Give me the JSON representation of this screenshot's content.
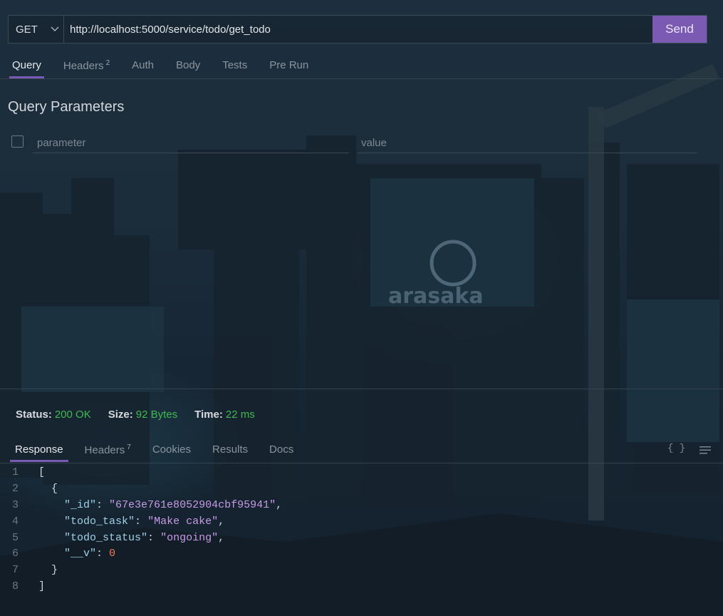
{
  "request": {
    "method": "GET",
    "url": "http://localhost:5000/service/todo/get_todo",
    "send_label": "Send"
  },
  "request_tabs": [
    {
      "label": "Query",
      "active": true
    },
    {
      "label": "Headers",
      "badge": "2"
    },
    {
      "label": "Auth"
    },
    {
      "label": "Body"
    },
    {
      "label": "Tests"
    },
    {
      "label": "Pre Run"
    }
  ],
  "query_params": {
    "title": "Query Parameters",
    "param_placeholder": "parameter",
    "value_placeholder": "value"
  },
  "status": {
    "status_label": "Status:",
    "status_value": "200 OK",
    "size_label": "Size:",
    "size_value": "92 Bytes",
    "time_label": "Time:",
    "time_value": "22 ms"
  },
  "response_tabs": [
    {
      "label": "Response",
      "active": true
    },
    {
      "label": "Headers",
      "badge": "7"
    },
    {
      "label": "Cookies"
    },
    {
      "label": "Results"
    },
    {
      "label": "Docs"
    }
  ],
  "response_tools": {
    "braces_icon": "{ }",
    "wrap_icon": "wrap-lines-icon"
  },
  "response_body": {
    "line_numbers": [
      "1",
      "2",
      "3",
      "4",
      "5",
      "6",
      "7",
      "8"
    ],
    "open_bracket": "[",
    "open_brace": "{",
    "fields": [
      {
        "key": "\"_id\"",
        "value": "\"67e3e761e8052904cbf95941\"",
        "type": "string"
      },
      {
        "key": "\"todo_task\"",
        "value": "\"Make cake\"",
        "type": "string"
      },
      {
        "key": "\"todo_status\"",
        "value": "\"ongoing\"",
        "type": "string"
      },
      {
        "key": "\"__v\"",
        "value": "0",
        "type": "number"
      }
    ],
    "close_brace": "}",
    "close_bracket": "]"
  },
  "colors": {
    "accent": "#7b5ab4",
    "success": "#3fb950",
    "json_key": "#9ed0e6",
    "json_string": "#c79be6",
    "json_number": "#f07a5a"
  }
}
